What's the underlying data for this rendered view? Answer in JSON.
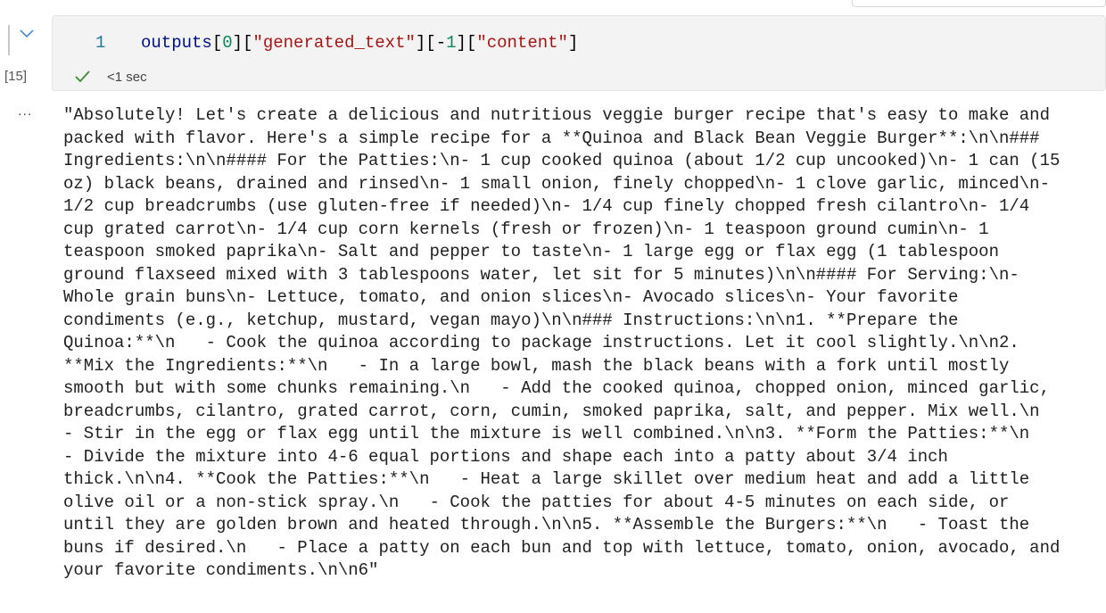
{
  "cell": {
    "execution_count": "[15]",
    "line_number": "1",
    "code_tokens": [
      {
        "t": "outputs",
        "k": "id"
      },
      {
        "t": "[",
        "k": "p"
      },
      {
        "t": "0",
        "k": "n"
      },
      {
        "t": "][",
        "k": "p"
      },
      {
        "t": "\"generated_text\"",
        "k": "s"
      },
      {
        "t": "][",
        "k": "p"
      },
      {
        "t": "-",
        "k": "p"
      },
      {
        "t": "1",
        "k": "n"
      },
      {
        "t": "][",
        "k": "p"
      },
      {
        "t": "\"content\"",
        "k": "s"
      },
      {
        "t": "]",
        "k": "p"
      }
    ],
    "status_icon": "check-icon",
    "duration": "<1 sec",
    "status_color": "#388a34"
  },
  "output": {
    "more_label": "...",
    "lines": [
      "\"Absolutely! Let's create a delicious and nutritious veggie burger recipe that's easy to make and",
      "packed with flavor. Here's a simple recipe for a **Quinoa and Black Bean Veggie Burger**:\\n\\n###",
      "Ingredients:\\n\\n#### For the Patties:\\n- 1 cup cooked quinoa (about 1/2 cup uncooked)\\n- 1 can (15",
      "oz) black beans, drained and rinsed\\n- 1 small onion, finely chopped\\n- 1 clove garlic, minced\\n-",
      "1/2 cup breadcrumbs (use gluten-free if needed)\\n- 1/4 cup finely chopped fresh cilantro\\n- 1/4",
      "cup grated carrot\\n- 1/4 cup corn kernels (fresh or frozen)\\n- 1 teaspoon ground cumin\\n- 1",
      "teaspoon smoked paprika\\n- Salt and pepper to taste\\n- 1 large egg or flax egg (1 tablespoon",
      "ground flaxseed mixed with 3 tablespoons water, let sit for 5 minutes)\\n\\n#### For Serving:\\n-",
      "Whole grain buns\\n- Lettuce, tomato, and onion slices\\n- Avocado slices\\n- Your favorite",
      "condiments (e.g., ketchup, mustard, vegan mayo)\\n\\n### Instructions:\\n\\n1. **Prepare the",
      "Quinoa:**\\n   - Cook the quinoa according to package instructions. Let it cool slightly.\\n\\n2.",
      "**Mix the Ingredients:**\\n   - In a large bowl, mash the black beans with a fork until mostly",
      "smooth but with some chunks remaining.\\n   - Add the cooked quinoa, chopped onion, minced garlic,",
      "breadcrumbs, cilantro, grated carrot, corn, cumin, smoked paprika, salt, and pepper. Mix well.\\n",
      "- Stir in the egg or flax egg until the mixture is well combined.\\n\\n3. **Form the Patties:**\\n",
      "- Divide the mixture into 4-6 equal portions and shape each into a patty about 3/4 inch",
      "thick.\\n\\n4. **Cook the Patties:**\\n   - Heat a large skillet over medium heat and add a little",
      "olive oil or a non-stick spray.\\n   - Cook the patties for about 4-5 minutes on each side, or",
      "until they are golden brown and heated through.\\n\\n5. **Assemble the Burgers:**\\n   - Toast the",
      "buns if desired.\\n   - Place a patty on each bun and top with lettuce, tomato, onion, avocado, and",
      "your favorite condiments.\\n\\n6\""
    ]
  }
}
